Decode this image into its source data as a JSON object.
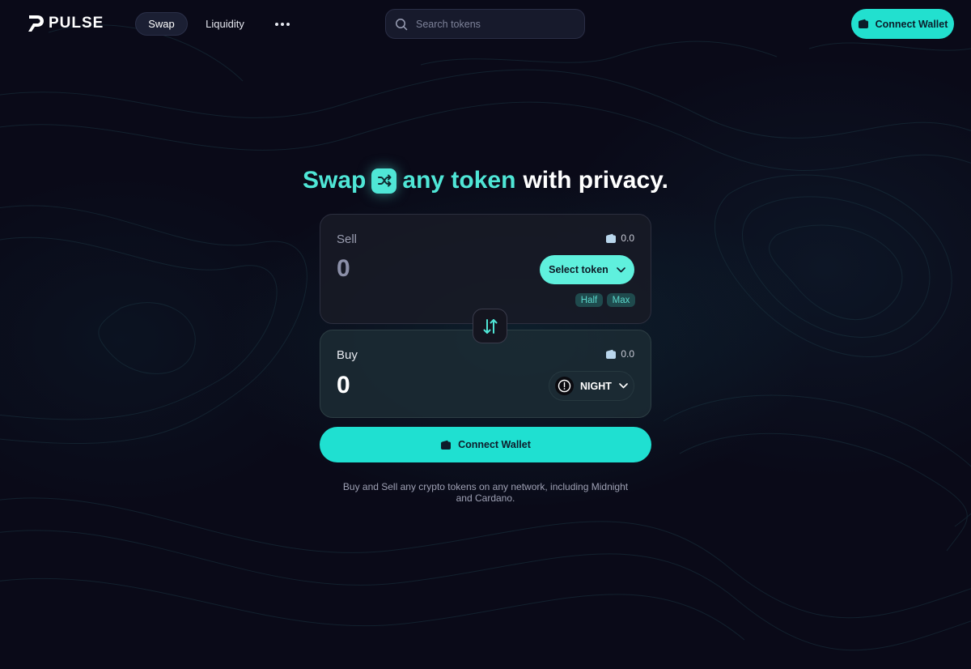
{
  "brand": {
    "name": "PULSE"
  },
  "nav": {
    "tabs": [
      {
        "label": "Swap",
        "active": true
      },
      {
        "label": "Liquidity",
        "active": false
      }
    ],
    "more_icon": "ellipsis-icon"
  },
  "search": {
    "placeholder": "Search tokens",
    "value": "",
    "icon": "search-icon"
  },
  "header": {
    "connect_label": "Connect Wallet",
    "wallet_icon": "wallet-icon"
  },
  "hero": {
    "part1": "Swap",
    "icon": "shuffle-icon",
    "part2": "any token",
    "part3": "with privacy."
  },
  "sell": {
    "label": "Sell",
    "balance": "0.0",
    "amount": "0",
    "token_button": "Select token",
    "half_label": "Half",
    "max_label": "Max"
  },
  "buy": {
    "label": "Buy",
    "balance": "0.0",
    "amount": "0",
    "token": "NIGHT"
  },
  "swap_toggle_icon": "swap-arrows-icon",
  "main_connect_label": "Connect Wallet",
  "footnote": "Buy and Sell any crypto tokens on any network, including Midnight and Cardano.",
  "colors": {
    "accent": "#22e0cf",
    "accent_light": "#5ff0dd",
    "background": "#0a0a18",
    "chip_bg": "#1f4a4d"
  }
}
